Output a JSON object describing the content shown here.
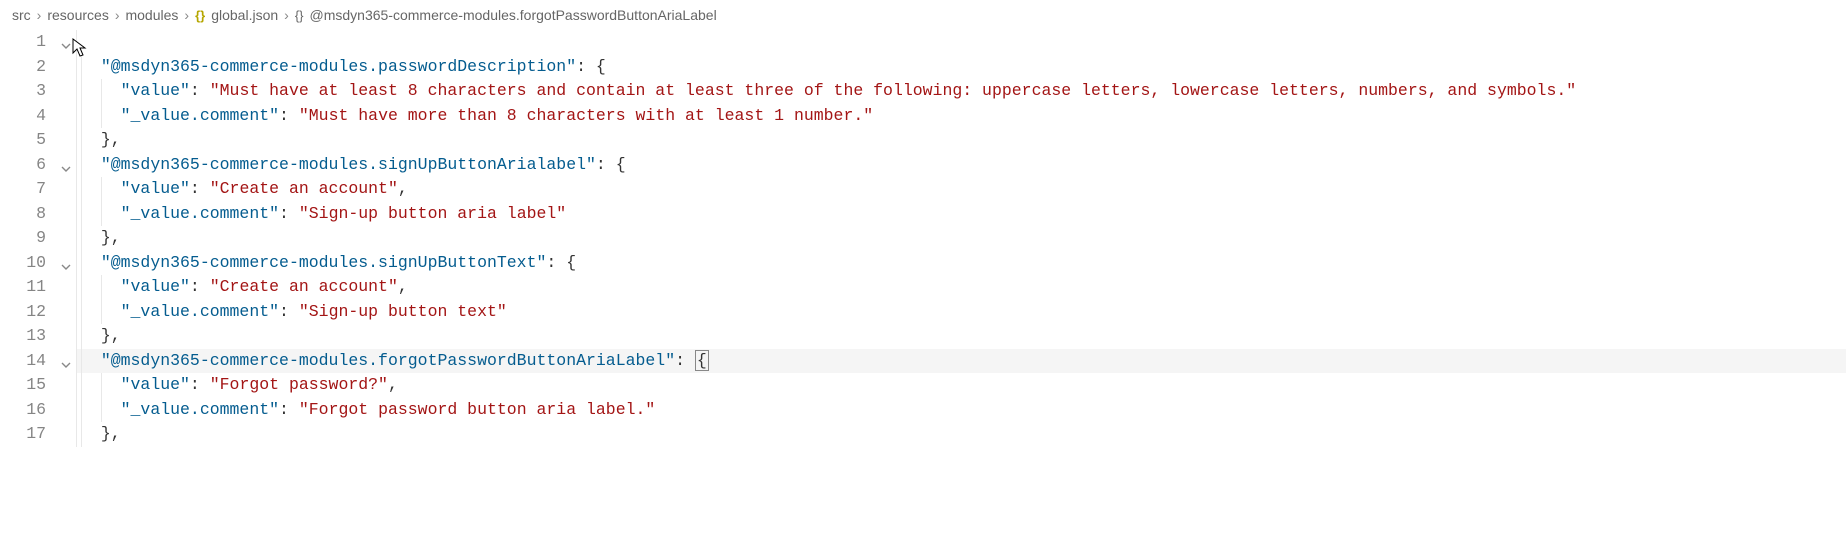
{
  "breadcrumb": {
    "items": [
      {
        "text": "src",
        "icon": null
      },
      {
        "text": "resources",
        "icon": null
      },
      {
        "text": "modules",
        "icon": null
      },
      {
        "text": "global.json",
        "icon": "{}"
      },
      {
        "text": "@msdyn365-commerce-modules.forgotPasswordButtonAriaLabel",
        "icon": "{}"
      }
    ]
  },
  "lines": [
    {
      "num": "1",
      "fold": "down",
      "indent": 0,
      "tokens": []
    },
    {
      "num": "2",
      "fold": "",
      "indent": 1,
      "tokens": [
        {
          "t": "key",
          "v": "\"@msdyn365-commerce-modules.passwordDescription\""
        },
        {
          "t": "punc",
          "v": ": {"
        }
      ]
    },
    {
      "num": "3",
      "fold": "",
      "indent": 2,
      "tokens": [
        {
          "t": "key",
          "v": "\"value\""
        },
        {
          "t": "punc",
          "v": ": "
        },
        {
          "t": "str",
          "v": "\"Must have at least 8 characters and contain at least three of the following: uppercase letters, lowercase letters, numbers, and symbols.\""
        }
      ]
    },
    {
      "num": "4",
      "fold": "",
      "indent": 2,
      "tokens": [
        {
          "t": "key",
          "v": "\"_value.comment\""
        },
        {
          "t": "punc",
          "v": ": "
        },
        {
          "t": "str",
          "v": "\"Must have more than 8 characters with at least 1 number.\""
        }
      ]
    },
    {
      "num": "5",
      "fold": "",
      "indent": 1,
      "tokens": [
        {
          "t": "punc",
          "v": "},"
        }
      ]
    },
    {
      "num": "6",
      "fold": "down",
      "indent": 1,
      "tokens": [
        {
          "t": "key",
          "v": "\"@msdyn365-commerce-modules.signUpButtonArialabel\""
        },
        {
          "t": "punc",
          "v": ": {"
        }
      ]
    },
    {
      "num": "7",
      "fold": "",
      "indent": 2,
      "tokens": [
        {
          "t": "key",
          "v": "\"value\""
        },
        {
          "t": "punc",
          "v": ": "
        },
        {
          "t": "str",
          "v": "\"Create an account\""
        },
        {
          "t": "punc",
          "v": ","
        }
      ]
    },
    {
      "num": "8",
      "fold": "",
      "indent": 2,
      "tokens": [
        {
          "t": "key",
          "v": "\"_value.comment\""
        },
        {
          "t": "punc",
          "v": ": "
        },
        {
          "t": "str",
          "v": "\"Sign-up button aria label\""
        }
      ]
    },
    {
      "num": "9",
      "fold": "",
      "indent": 1,
      "tokens": [
        {
          "t": "punc",
          "v": "},"
        }
      ]
    },
    {
      "num": "10",
      "fold": "down",
      "indent": 1,
      "tokens": [
        {
          "t": "key",
          "v": "\"@msdyn365-commerce-modules.signUpButtonText\""
        },
        {
          "t": "punc",
          "v": ": {"
        }
      ]
    },
    {
      "num": "11",
      "fold": "",
      "indent": 2,
      "tokens": [
        {
          "t": "key",
          "v": "\"value\""
        },
        {
          "t": "punc",
          "v": ": "
        },
        {
          "t": "str",
          "v": "\"Create an account\""
        },
        {
          "t": "punc",
          "v": ","
        }
      ]
    },
    {
      "num": "12",
      "fold": "",
      "indent": 2,
      "tokens": [
        {
          "t": "key",
          "v": "\"_value.comment\""
        },
        {
          "t": "punc",
          "v": ": "
        },
        {
          "t": "str",
          "v": "\"Sign-up button text\""
        }
      ]
    },
    {
      "num": "13",
      "fold": "",
      "indent": 1,
      "tokens": [
        {
          "t": "punc",
          "v": "},"
        }
      ]
    },
    {
      "num": "14",
      "fold": "down",
      "indent": 1,
      "highlighted": true,
      "tokens": [
        {
          "t": "key",
          "v": "\"@msdyn365-commerce-modules.forgotPasswordButtonAriaLabel\""
        },
        {
          "t": "punc",
          "v": ": "
        },
        {
          "t": "cursor",
          "v": "{"
        }
      ]
    },
    {
      "num": "15",
      "fold": "",
      "indent": 2,
      "tokens": [
        {
          "t": "key",
          "v": "\"value\""
        },
        {
          "t": "punc",
          "v": ": "
        },
        {
          "t": "str",
          "v": "\"Forgot password?\""
        },
        {
          "t": "punc",
          "v": ","
        }
      ]
    },
    {
      "num": "16",
      "fold": "",
      "indent": 2,
      "tokens": [
        {
          "t": "key",
          "v": "\"_value.comment\""
        },
        {
          "t": "punc",
          "v": ": "
        },
        {
          "t": "str",
          "v": "\"Forgot password button aria label.\""
        }
      ]
    },
    {
      "num": "17",
      "fold": "",
      "indent": 1,
      "tokens": [
        {
          "t": "punc",
          "v": "},"
        }
      ]
    }
  ],
  "cursor_icon": "↖"
}
